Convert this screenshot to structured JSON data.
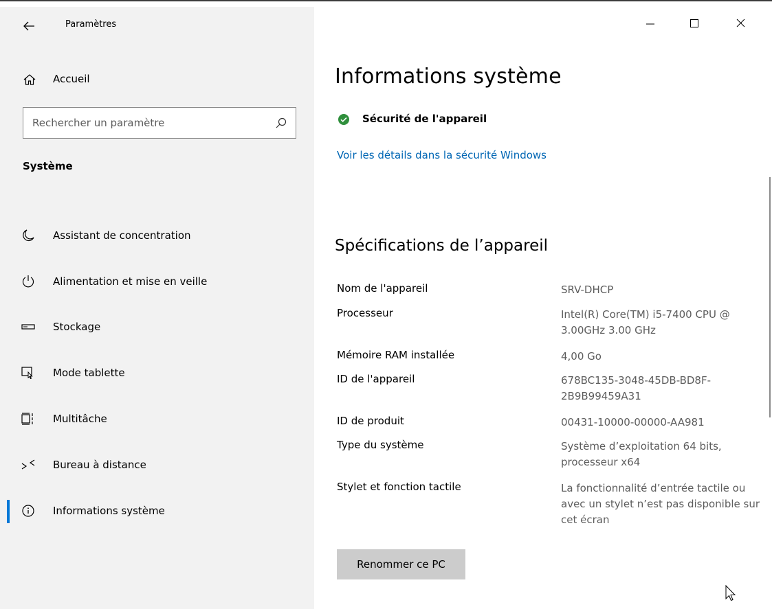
{
  "window": {
    "title": "Paramètres",
    "controls": {
      "minimize": "minimize",
      "maximize": "maximize",
      "close": "close"
    }
  },
  "sidebar": {
    "home_label": "Accueil",
    "search_placeholder": "Rechercher un paramètre",
    "section": "Système",
    "items": [
      {
        "label": "Assistant de concentration",
        "icon": "moon-icon",
        "selected": false
      },
      {
        "label": "Alimentation et mise en veille",
        "icon": "power-icon",
        "selected": false
      },
      {
        "label": "Stockage",
        "icon": "storage-icon",
        "selected": false
      },
      {
        "label": "Mode tablette",
        "icon": "tablet-mode-icon",
        "selected": false
      },
      {
        "label": "Multitâche",
        "icon": "multitask-icon",
        "selected": false
      },
      {
        "label": "Bureau à distance",
        "icon": "remote-desktop-icon",
        "selected": false
      },
      {
        "label": "Informations système",
        "icon": "info-icon",
        "selected": true
      }
    ]
  },
  "main": {
    "title": "Informations système",
    "security_status": "Sécurité de l'appareil",
    "security_link": "Voir les détails dans la sécurité Windows",
    "specs_heading": "Spécifications de l’appareil",
    "specs": [
      {
        "label": "Nom de l'appareil",
        "value": "SRV-DHCP"
      },
      {
        "label": "Processeur",
        "value": "Intel(R) Core(TM) i5-7400 CPU @ 3.00GHz   3.00 GHz"
      },
      {
        "label": "Mémoire RAM installée",
        "value": "4,00 Go"
      },
      {
        "label": "ID de l'appareil",
        "value": "678BC135-3048-45DB-BD8F-2B9B99459A31"
      },
      {
        "label": "ID de produit",
        "value": "00431-10000-00000-AA981"
      },
      {
        "label": "Type du système",
        "value": "Système d’exploitation 64 bits, processeur x64"
      },
      {
        "label": "Stylet et fonction tactile",
        "value": "La fonctionnalité d’entrée tactile ou avec un stylet n’est pas disponible sur cet écran"
      }
    ],
    "rename_button": "Renommer ce PC"
  },
  "colors": {
    "accent": "#0078d7",
    "link": "#0066b4",
    "success": "#2f8f3c",
    "sidebar_bg": "#f2f2f2",
    "button_bg": "#cccccc"
  }
}
